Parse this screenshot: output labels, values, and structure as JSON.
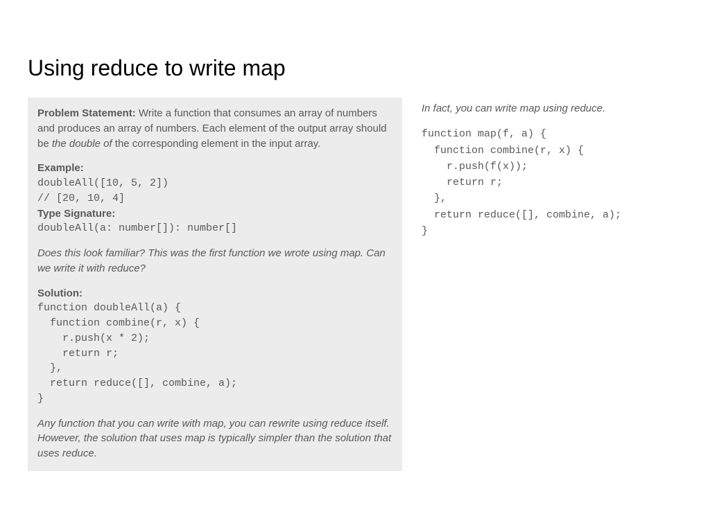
{
  "title": "Using reduce to write map",
  "left": {
    "ps_label": "Problem Statement: ",
    "ps_text1": "Write a function that consumes an array of numbers and produces an array of numbers. Each element of the output array should be ",
    "ps_italic": "the double of ",
    "ps_text2": "the corresponding element in the input array.",
    "example_label": "Example:",
    "example_code": "doubleAll([10, 5, 2])\n// [20, 10, 4]",
    "typesig_label": "Type Signature:",
    "typesig_code": "doubleAll(a: number[]): number[]",
    "familiar": "Does this look familiar? This was the first function we wrote using map. Can we write it with reduce?",
    "solution_label": "Solution:",
    "solution_code": "function doubleAll(a) {\n  function combine(r, x) {\n    r.push(x * 2);\n    return r;\n  },\n  return reduce([], combine, a);\n}",
    "footer": "Any function that you can write with map, you can rewrite using reduce itself. However, the solution that uses map is typically simpler than the solution that uses reduce."
  },
  "right": {
    "intro": "In fact, you can write map using reduce.",
    "code": "function map(f, a) {\n  function combine(r, x) {\n    r.push(f(x));\n    return r;\n  },\n  return reduce([], combine, a);\n}"
  }
}
